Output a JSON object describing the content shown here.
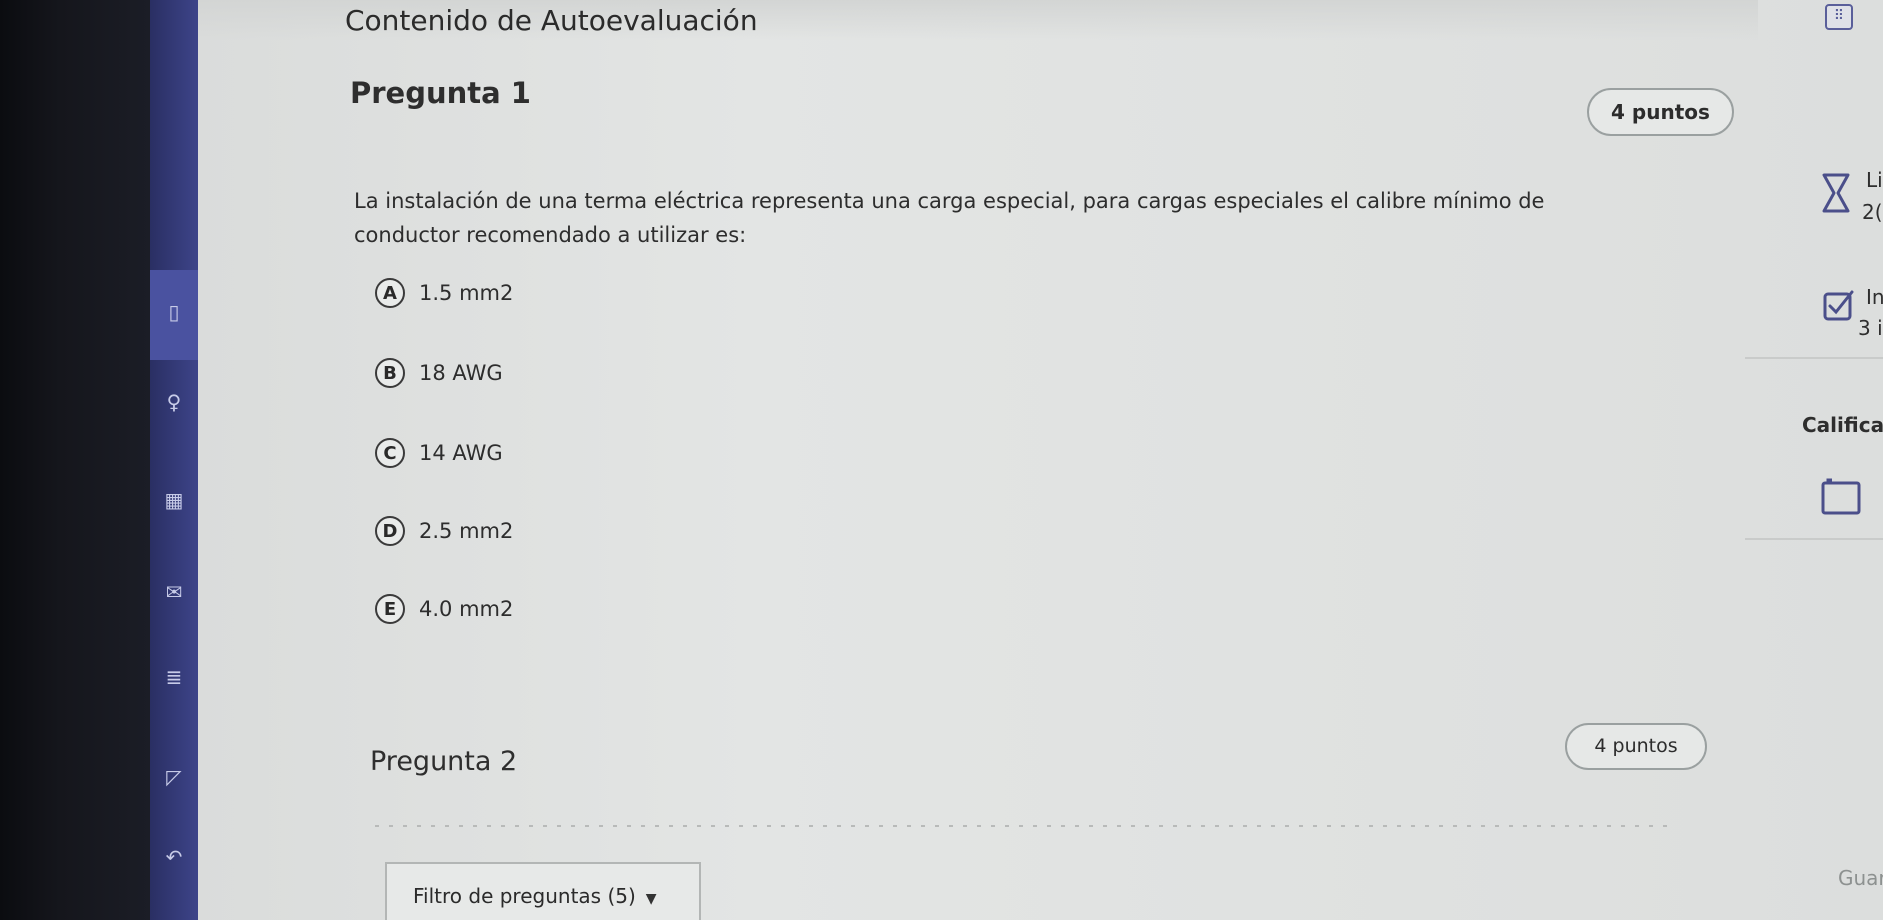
{
  "page": {
    "heading": "Contenido de Autoevaluación"
  },
  "question1": {
    "title": "Pregunta 1",
    "points": "4 puntos",
    "text": "La instalación de una terma eléctrica representa una carga especial, para cargas especiales el calibre mínimo de conductor recomendado a utilizar es:",
    "options": [
      {
        "letter": "A",
        "label": "1.5 mm2"
      },
      {
        "letter": "B",
        "label": "18 AWG"
      },
      {
        "letter": "C",
        "label": "14 AWG"
      },
      {
        "letter": "D",
        "label": "2.5 mm2"
      },
      {
        "letter": "E",
        "label": "4.0 mm2"
      }
    ]
  },
  "question2": {
    "title": "Pregunta 2",
    "points": "4 puntos"
  },
  "filter": {
    "label": "Filtro de preguntas (5)"
  },
  "right_panel": {
    "time_label": "Li",
    "time_value": "2(",
    "attempts_label": "In",
    "attempts_value": "3 i",
    "grade_label": "Califica",
    "save_label": "Guar"
  },
  "icons": {
    "grid": "grid-icon",
    "hourglass": "hourglass-icon",
    "check": "checkbox-icon",
    "grade_box": "box-icon",
    "filter_caret": "caret-down-icon"
  },
  "colors": {
    "nav": "#3d4489",
    "page_bg": "#e0e2e1",
    "text": "#2d2d2d"
  }
}
